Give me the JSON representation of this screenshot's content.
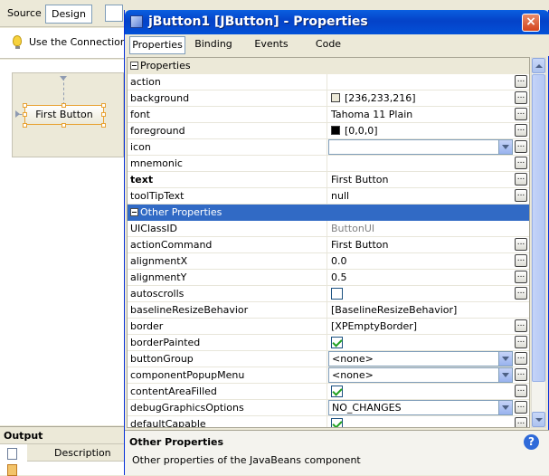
{
  "ide": {
    "tabs": [
      {
        "label": "Source"
      },
      {
        "label": "Design"
      }
    ],
    "hint": "Use the Connection M",
    "design_button": "First Button",
    "output": {
      "title": "Output",
      "col_description": "Description"
    }
  },
  "window": {
    "title": "jButton1 [JButton] - Properties",
    "close": "×",
    "tabs": [
      {
        "label": "Properties"
      },
      {
        "label": "Binding"
      },
      {
        "label": "Events"
      },
      {
        "label": "Code"
      }
    ]
  },
  "grid": {
    "categories": {
      "properties": "Properties",
      "other": "Other Properties"
    },
    "rows": [
      {
        "name": "action",
        "value": ""
      },
      {
        "name": "background",
        "value": "[236,233,216]",
        "swatch": "#ece9d8"
      },
      {
        "name": "font",
        "value": "Tahoma 11 Plain"
      },
      {
        "name": "foreground",
        "value": "[0,0,0]",
        "swatch": "#000000"
      },
      {
        "name": "icon",
        "value": ""
      },
      {
        "name": "mnemonic",
        "value": ""
      },
      {
        "name": "text",
        "value": "First Button"
      },
      {
        "name": "toolTipText",
        "value": "null"
      },
      {
        "name": "UIClassID",
        "value": "ButtonUI"
      },
      {
        "name": "actionCommand",
        "value": "First Button"
      },
      {
        "name": "alignmentX",
        "value": "0.0"
      },
      {
        "name": "alignmentY",
        "value": "0.5"
      },
      {
        "name": "autoscrolls",
        "value": "unchecked"
      },
      {
        "name": "baselineResizeBehavior",
        "value": "[BaselineResizeBehavior]"
      },
      {
        "name": "border",
        "value": "[XPEmptyBorder]"
      },
      {
        "name": "borderPainted",
        "value": "checked"
      },
      {
        "name": "buttonGroup",
        "value": "<none>"
      },
      {
        "name": "componentPopupMenu",
        "value": "<none>"
      },
      {
        "name": "contentAreaFilled",
        "value": "checked"
      },
      {
        "name": "debugGraphicsOptions",
        "value": "NO_CHANGES"
      },
      {
        "name": "defaultCapable",
        "value": "checked"
      }
    ]
  },
  "description": {
    "title": "Other Properties",
    "text": "Other properties of the JavaBeans component",
    "help": "?"
  },
  "ellipsis": "..."
}
